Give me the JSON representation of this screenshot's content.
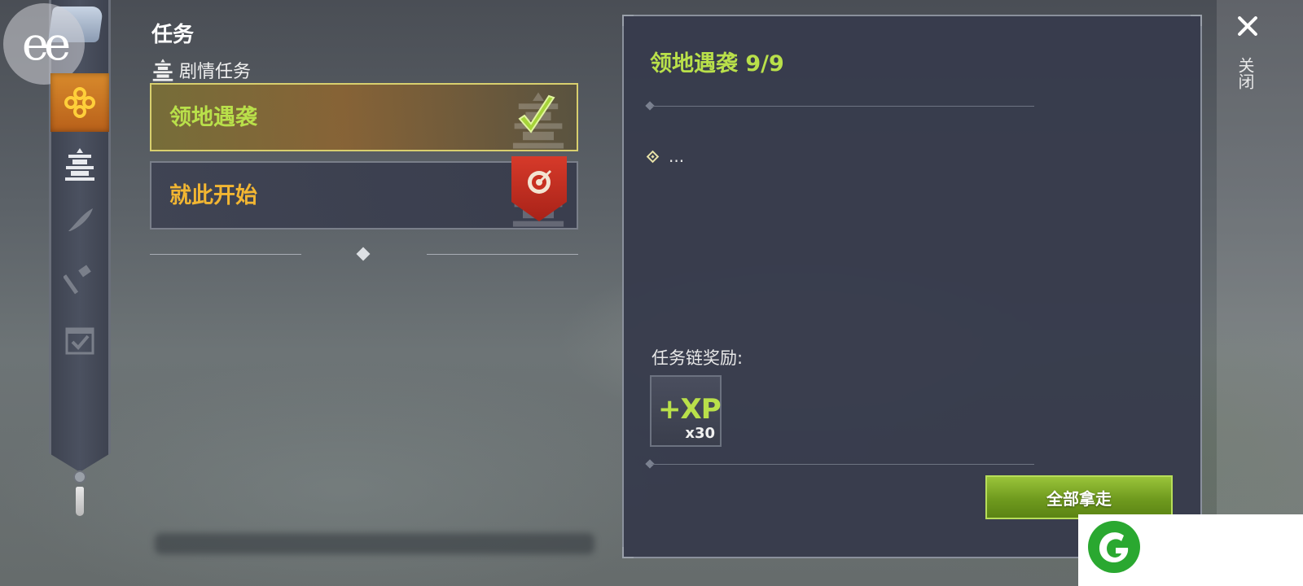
{
  "header": {
    "title": "任务",
    "category_label": "剧情任务"
  },
  "logo": {
    "text": "ee"
  },
  "nav": {
    "items": [
      {
        "icon": "quest-dots-icon",
        "active": true
      },
      {
        "icon": "pagoda-icon",
        "active": false
      },
      {
        "icon": "feather-icon",
        "active": false
      },
      {
        "icon": "hammer-icon",
        "active": false
      },
      {
        "icon": "calendar-check-icon",
        "active": false
      }
    ]
  },
  "quests": [
    {
      "name": "领地遇袭",
      "status": "completed",
      "name_color": "#b9e04a"
    },
    {
      "name": "就此开始",
      "status": "active",
      "name_color": "#f2b632"
    }
  ],
  "detail": {
    "title": "领地遇袭 9/9",
    "objective_text": "...",
    "rewards_label": "任务链奖励:",
    "reward": {
      "label": "+XP",
      "quantity": "x30"
    },
    "claim_button": "全部拿走"
  },
  "close": {
    "label": "关闭"
  },
  "colors": {
    "accent_green": "#b9e04a",
    "accent_orange": "#f2b632",
    "nav_active": "#d88a2c",
    "badge_red": "#c83020"
  }
}
